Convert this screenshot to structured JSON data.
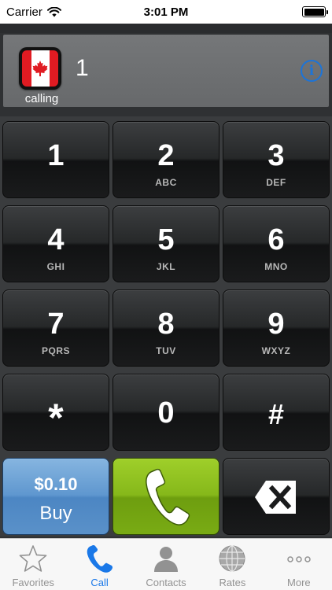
{
  "status_bar": {
    "carrier": "Carrier",
    "time": "3:01 PM"
  },
  "display": {
    "calling_label": "calling",
    "number": "1",
    "info_glyph": "i",
    "country_flag": "canada-flag-icon"
  },
  "keypad": {
    "keys": [
      {
        "digit": "1",
        "letters": ""
      },
      {
        "digit": "2",
        "letters": "ABC"
      },
      {
        "digit": "3",
        "letters": "DEF"
      },
      {
        "digit": "4",
        "letters": "GHI"
      },
      {
        "digit": "5",
        "letters": "JKL"
      },
      {
        "digit": "6",
        "letters": "MNO"
      },
      {
        "digit": "7",
        "letters": "PQRS"
      },
      {
        "digit": "8",
        "letters": "TUV"
      },
      {
        "digit": "9",
        "letters": "WXYZ"
      },
      {
        "digit": "*",
        "letters": ""
      },
      {
        "digit": "0",
        "letters": ""
      },
      {
        "digit": "#",
        "letters": ""
      }
    ],
    "buy_price": "$0.10",
    "buy_label": "Buy"
  },
  "tab_bar": {
    "tabs": [
      {
        "label": "Favorites",
        "icon": "star-icon"
      },
      {
        "label": "Call",
        "icon": "phone-icon"
      },
      {
        "label": "Contacts",
        "icon": "person-icon"
      },
      {
        "label": "Rates",
        "icon": "globe-icon"
      },
      {
        "label": "More",
        "icon": "more-icon"
      }
    ],
    "active": "Call"
  },
  "colors": {
    "accent_blue": "#1a78e8",
    "call_green": "#86b81a",
    "buy_blue": "#5f97cf",
    "flag_red": "#e01b22"
  }
}
